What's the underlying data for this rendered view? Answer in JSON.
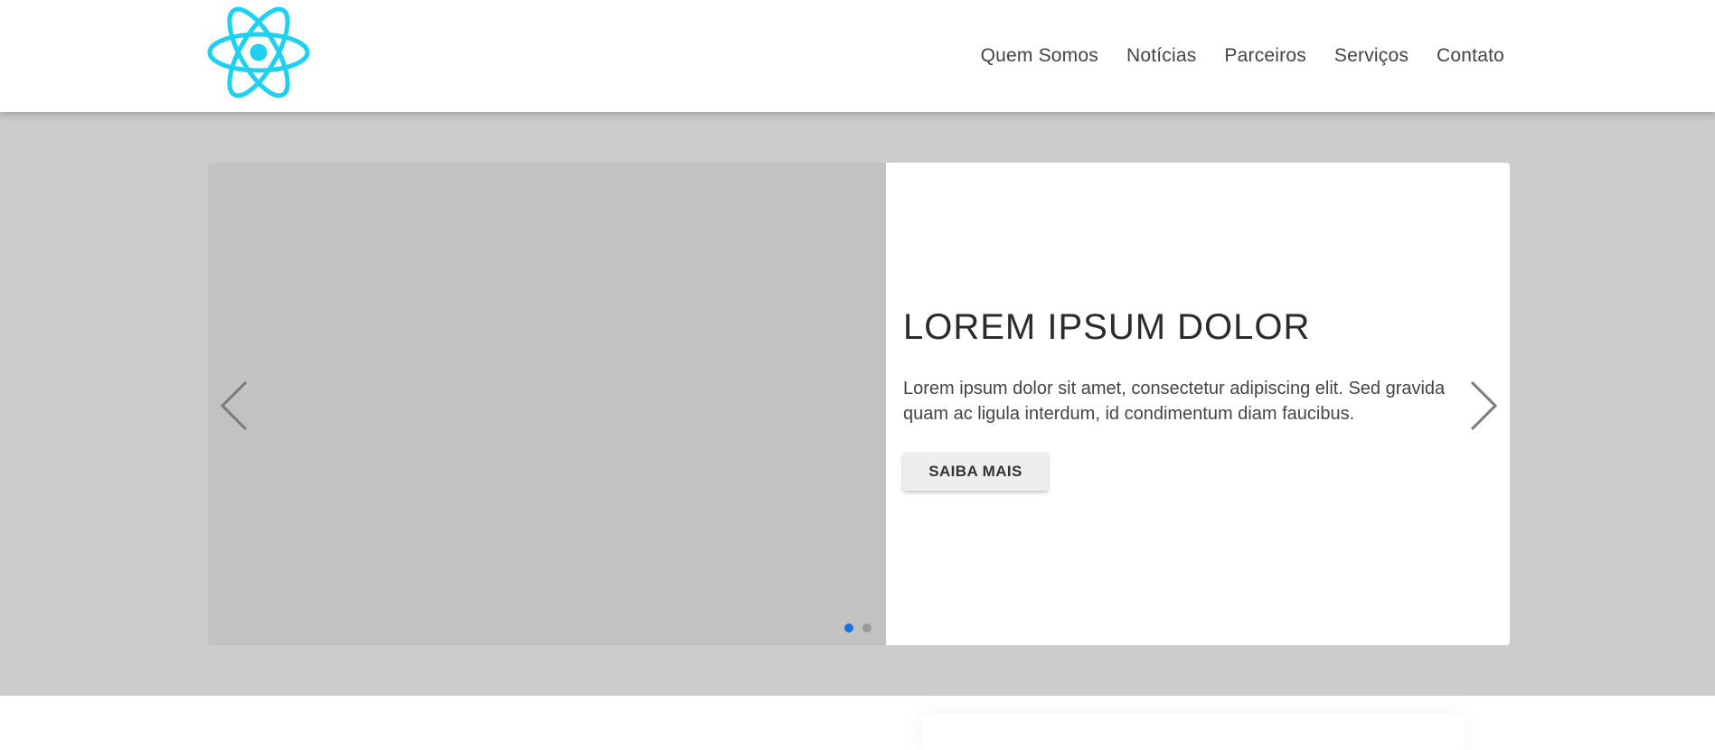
{
  "header": {
    "logo_icon": "react-atom-icon",
    "logo_color": "#1fd0f1",
    "nav": [
      {
        "label": "Quem Somos"
      },
      {
        "label": "Notícias"
      },
      {
        "label": "Parceiros"
      },
      {
        "label": "Serviços"
      },
      {
        "label": "Contato"
      }
    ]
  },
  "hero": {
    "title": "LOREM IPSUM DOLOR",
    "text": "Lorem ipsum dolor sit amet, consectetur adipiscing elit. Sed gravida quam ac ligula interdum, id condimentum diam faucibus.",
    "button_label": "SAIBA MAIS",
    "prev_icon": "chevron-left-icon",
    "next_icon": "chevron-right-icon",
    "slides_total": 2,
    "active_slide": 1
  },
  "colors": {
    "band_background": "#cccccc",
    "image_placeholder": "#c2c2c2",
    "dot_active": "#1a73e8",
    "dot_inactive": "#9a9a9a"
  }
}
